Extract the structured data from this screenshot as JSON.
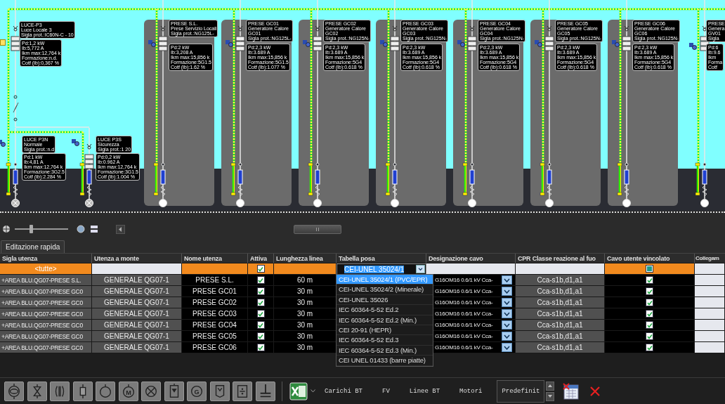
{
  "diagram": {
    "lighting_group": {
      "title_lines": [
        "LUCE-P3",
        "Luce Locale 3",
        "Sigla prot.:IC60N-C - 10"
      ],
      "data_lines": [
        "Pd:1,2 kW",
        "Ib:5,772 A",
        "Ikm max:12,764 k",
        "Formazione:n.d.",
        "Cotf (Ib):0,367 %"
      ],
      "branches": [
        {
          "title_lines": [
            "LUCE P3N",
            "Normale",
            "Sigla prot.:n.d"
          ],
          "data_lines": [
            "Pd:1 kW",
            "Ib:4,81 A",
            "Ikm max:12,764 k",
            "Formazione:3G2.5",
            "Cotf (Ib):2.284 %"
          ],
          "kind": "lamp"
        },
        {
          "title_lines": [
            "LUCE P3S",
            "Sicurezza",
            "Sigla prot.:1 20"
          ],
          "data_lines": [
            "Pd:0,2 kW",
            "Ib:0.962 A",
            "Ikm max:12,764 k",
            "Formazione:3G1.5",
            "Cotf (Ib):1.004 %"
          ],
          "kind": "lamp"
        }
      ]
    },
    "panels": [
      {
        "title_lines": [
          "PRESE S.L.",
          "Prese Servizio Locali",
          "Sigla prot.:NG125L-"
        ],
        "data_lines": [
          "Pd:2 kW",
          "Ib:3,208 A",
          "Ikm max:15,856 k",
          "Formazione:5G1.5",
          "Cotf (Ib):1.62 %"
        ],
        "kind": "socket"
      },
      {
        "title_lines": [
          "PRESE GC01",
          "Generatore Calore",
          "GC01",
          "Sigla prot.:NG125L-"
        ],
        "data_lines": [
          "Pd:2,3 kW",
          "Ib:3.689 A",
          "Ikm max:15,856 k",
          "Formazione:5G1.5",
          "Cotf (Ib):1.077 %"
        ],
        "kind": "socket"
      },
      {
        "title_lines": [
          "PRESE GC02",
          "Generatore Calore",
          "GC02",
          "Sigla prot.:NG125N-"
        ],
        "data_lines": [
          "Pd:2,3 kW",
          "Ib:3.689 A",
          "Ikm max:15,856 k",
          "Formazione:5G4",
          "Cotf (Ib):0.618 %"
        ],
        "kind": "socket"
      },
      {
        "title_lines": [
          "PRESE GC03",
          "Generatore Calore",
          "GC03",
          "Sigla prot.:NG125N-"
        ],
        "data_lines": [
          "Pd:2,3 kW",
          "Ib:3.689 A",
          "Ikm max:15,856 k",
          "Formazione:5G4",
          "Cotf (Ib):0.618 %"
        ],
        "kind": "socket"
      },
      {
        "title_lines": [
          "PRESE GC04",
          "Generatore Calore",
          "GC04",
          "Sigla prot.:NG125N-"
        ],
        "data_lines": [
          "Pd:2,3 kW",
          "Ib:3.689 A",
          "Ikm max:15,856 k",
          "Formazione:5G4",
          "Cotf (Ib):0.618 %"
        ],
        "kind": "socket"
      },
      {
        "title_lines": [
          "PRESE GC05",
          "Generatore Calore",
          "GC05",
          "Sigla prot.:NG125N-"
        ],
        "data_lines": [
          "Pd:2,3 kW",
          "Ib:3.689 A",
          "Ikm max:15,856 k",
          "Formazione:5G4",
          "Cotf (Ib):0.618 %"
        ],
        "kind": "socket"
      },
      {
        "title_lines": [
          "PRESE GC06",
          "Generatore Calore",
          "GC06",
          "Sigla prot.:NG125N-"
        ],
        "data_lines": [
          "Pd:2,3 kW",
          "Ib:3.689 A",
          "Ikm max:15,856 k",
          "Formazione:5G4",
          "Cotf (Ib):0.618 %"
        ],
        "kind": "socket"
      }
    ],
    "edge_feeder": {
      "title_lines": [
        "PRESE",
        "Genera",
        "GV01",
        "Sigla"
      ],
      "data_lines": [
        "Pd:6",
        "Ib:9.6",
        "Ikm",
        "Forma",
        "Cotf"
      ],
      "kind": "socket"
    }
  },
  "zoom_slider": {
    "level": 0.3
  },
  "tabs": [
    {
      "label": "Editazione rapida",
      "selected": true
    }
  ],
  "table": {
    "columns": [
      "Sigla utenza",
      "Utenza a monte",
      "Nome utenza",
      "Attiva",
      "Lunghezza linea",
      "Tabella posa",
      "Designazione cavo",
      "CPR Classe reazione al fuo",
      "Cavo utente vincolato",
      "Collegam"
    ],
    "filter_row": {
      "sigla": "<tutte>",
      "attiva": true,
      "posa": "CEI-UNEL 35024/1",
      "vincolato_mixed": true
    },
    "rows": [
      {
        "sigla": "+AREA BLU.QG07-PRESE S.L.",
        "monte": "GENERALE QG07-1",
        "nome": "PRESE S.L.",
        "attiva": true,
        "lunghezza": "60 m",
        "designazione": "G16OM16 0.6/1 kV  Cca-",
        "cpr": "Cca-s1b,d1,a1",
        "vincolato": true
      },
      {
        "sigla": "+AREA BLU.QG07-PRESE GC0",
        "monte": "GENERALE QG07-1",
        "nome": "PRESE GC01",
        "attiva": true,
        "lunghezza": "30 m",
        "designazione": "G16OM16 0.6/1 kV  Cca-",
        "cpr": "Cca-s1b,d1,a1",
        "vincolato": true
      },
      {
        "sigla": "+AREA BLU.QG07-PRESE GC0",
        "monte": "GENERALE QG07-1",
        "nome": "PRESE GC02",
        "attiva": true,
        "lunghezza": "30 m",
        "designazione": "G16OM16 0.6/1 kV  Cca-",
        "cpr": "Cca-s1b,d1,a1",
        "vincolato": true
      },
      {
        "sigla": "+AREA BLU.QG07-PRESE GC0",
        "monte": "GENERALE QG07-1",
        "nome": "PRESE GC03",
        "attiva": true,
        "lunghezza": "30 m",
        "designazione": "G16OM16 0.6/1 kV  Cca-",
        "cpr": "Cca-s1b,d1,a1",
        "vincolato": true
      },
      {
        "sigla": "+AREA BLU.QG07-PRESE GC0",
        "monte": "GENERALE QG07-1",
        "nome": "PRESE GC04",
        "attiva": true,
        "lunghezza": "30 m",
        "designazione": "G16OM16 0.6/1 kV  Cca-",
        "cpr": "Cca-s1b,d1,a1",
        "vincolato": true
      },
      {
        "sigla": "+AREA BLU.QG07-PRESE GC0",
        "monte": "GENERALE QG07-1",
        "nome": "PRESE GC05",
        "attiva": true,
        "lunghezza": "30 m",
        "designazione": "G16OM16 0.6/1 kV  Cca-",
        "cpr": "Cca-s1b,d1,a1",
        "vincolato": true
      },
      {
        "sigla": "+AREA BLU.QG07-PRESE GC0",
        "monte": "GENERALE QG07-1",
        "nome": "PRESE GC06",
        "attiva": true,
        "lunghezza": "30 m",
        "designazione": "G16OM16 0.6/1 kV  Cca-",
        "cpr": "Cca-s1b,d1,a1",
        "vincolato": true
      }
    ]
  },
  "posa_dropdown": {
    "options": [
      {
        "label": "CEI-UNEL 35024/1 (PVC/EPR)",
        "selected": true
      },
      {
        "label": "CEI-UNEL 35024/2 (Minerale)",
        "selected": false
      },
      {
        "label": "CEI-UNEL 35026",
        "selected": false
      },
      {
        "label": "IEC 60364-5-52 Ed.2",
        "selected": false
      },
      {
        "label": "IEC 60364-5-52 Ed.2 (Min.)",
        "selected": false
      },
      {
        "label": "CEI 20-91 (HEPR)",
        "selected": false
      },
      {
        "label": "IEC 60364-5-52 Ed.3",
        "selected": false
      },
      {
        "label": "IEC 60364-5-52 Ed.3 (Min.)",
        "selected": false
      },
      {
        "label": "CEI UNEL 01433 (barre piatte)",
        "selected": false
      }
    ]
  },
  "bottom_toolbar": {
    "symbols": [
      {
        "kind": "transformer"
      },
      {
        "kind": "disconnector"
      },
      {
        "kind": "capacitor"
      },
      {
        "kind": "fuse"
      },
      {
        "kind": "load"
      },
      {
        "kind": "motor",
        "letter": "M"
      },
      {
        "kind": "lamp"
      },
      {
        "kind": "socket"
      },
      {
        "kind": "generator",
        "letter": "G"
      },
      {
        "kind": "meter"
      },
      {
        "kind": "charger"
      },
      {
        "kind": "ground"
      }
    ],
    "tabs": [
      {
        "label": "Carichi BT",
        "selected": false
      },
      {
        "label": "FV",
        "selected": false
      },
      {
        "label": "Linee BT",
        "selected": false
      },
      {
        "label": "Motori",
        "selected": false
      },
      {
        "label": "Predefinit",
        "selected": true
      }
    ]
  }
}
